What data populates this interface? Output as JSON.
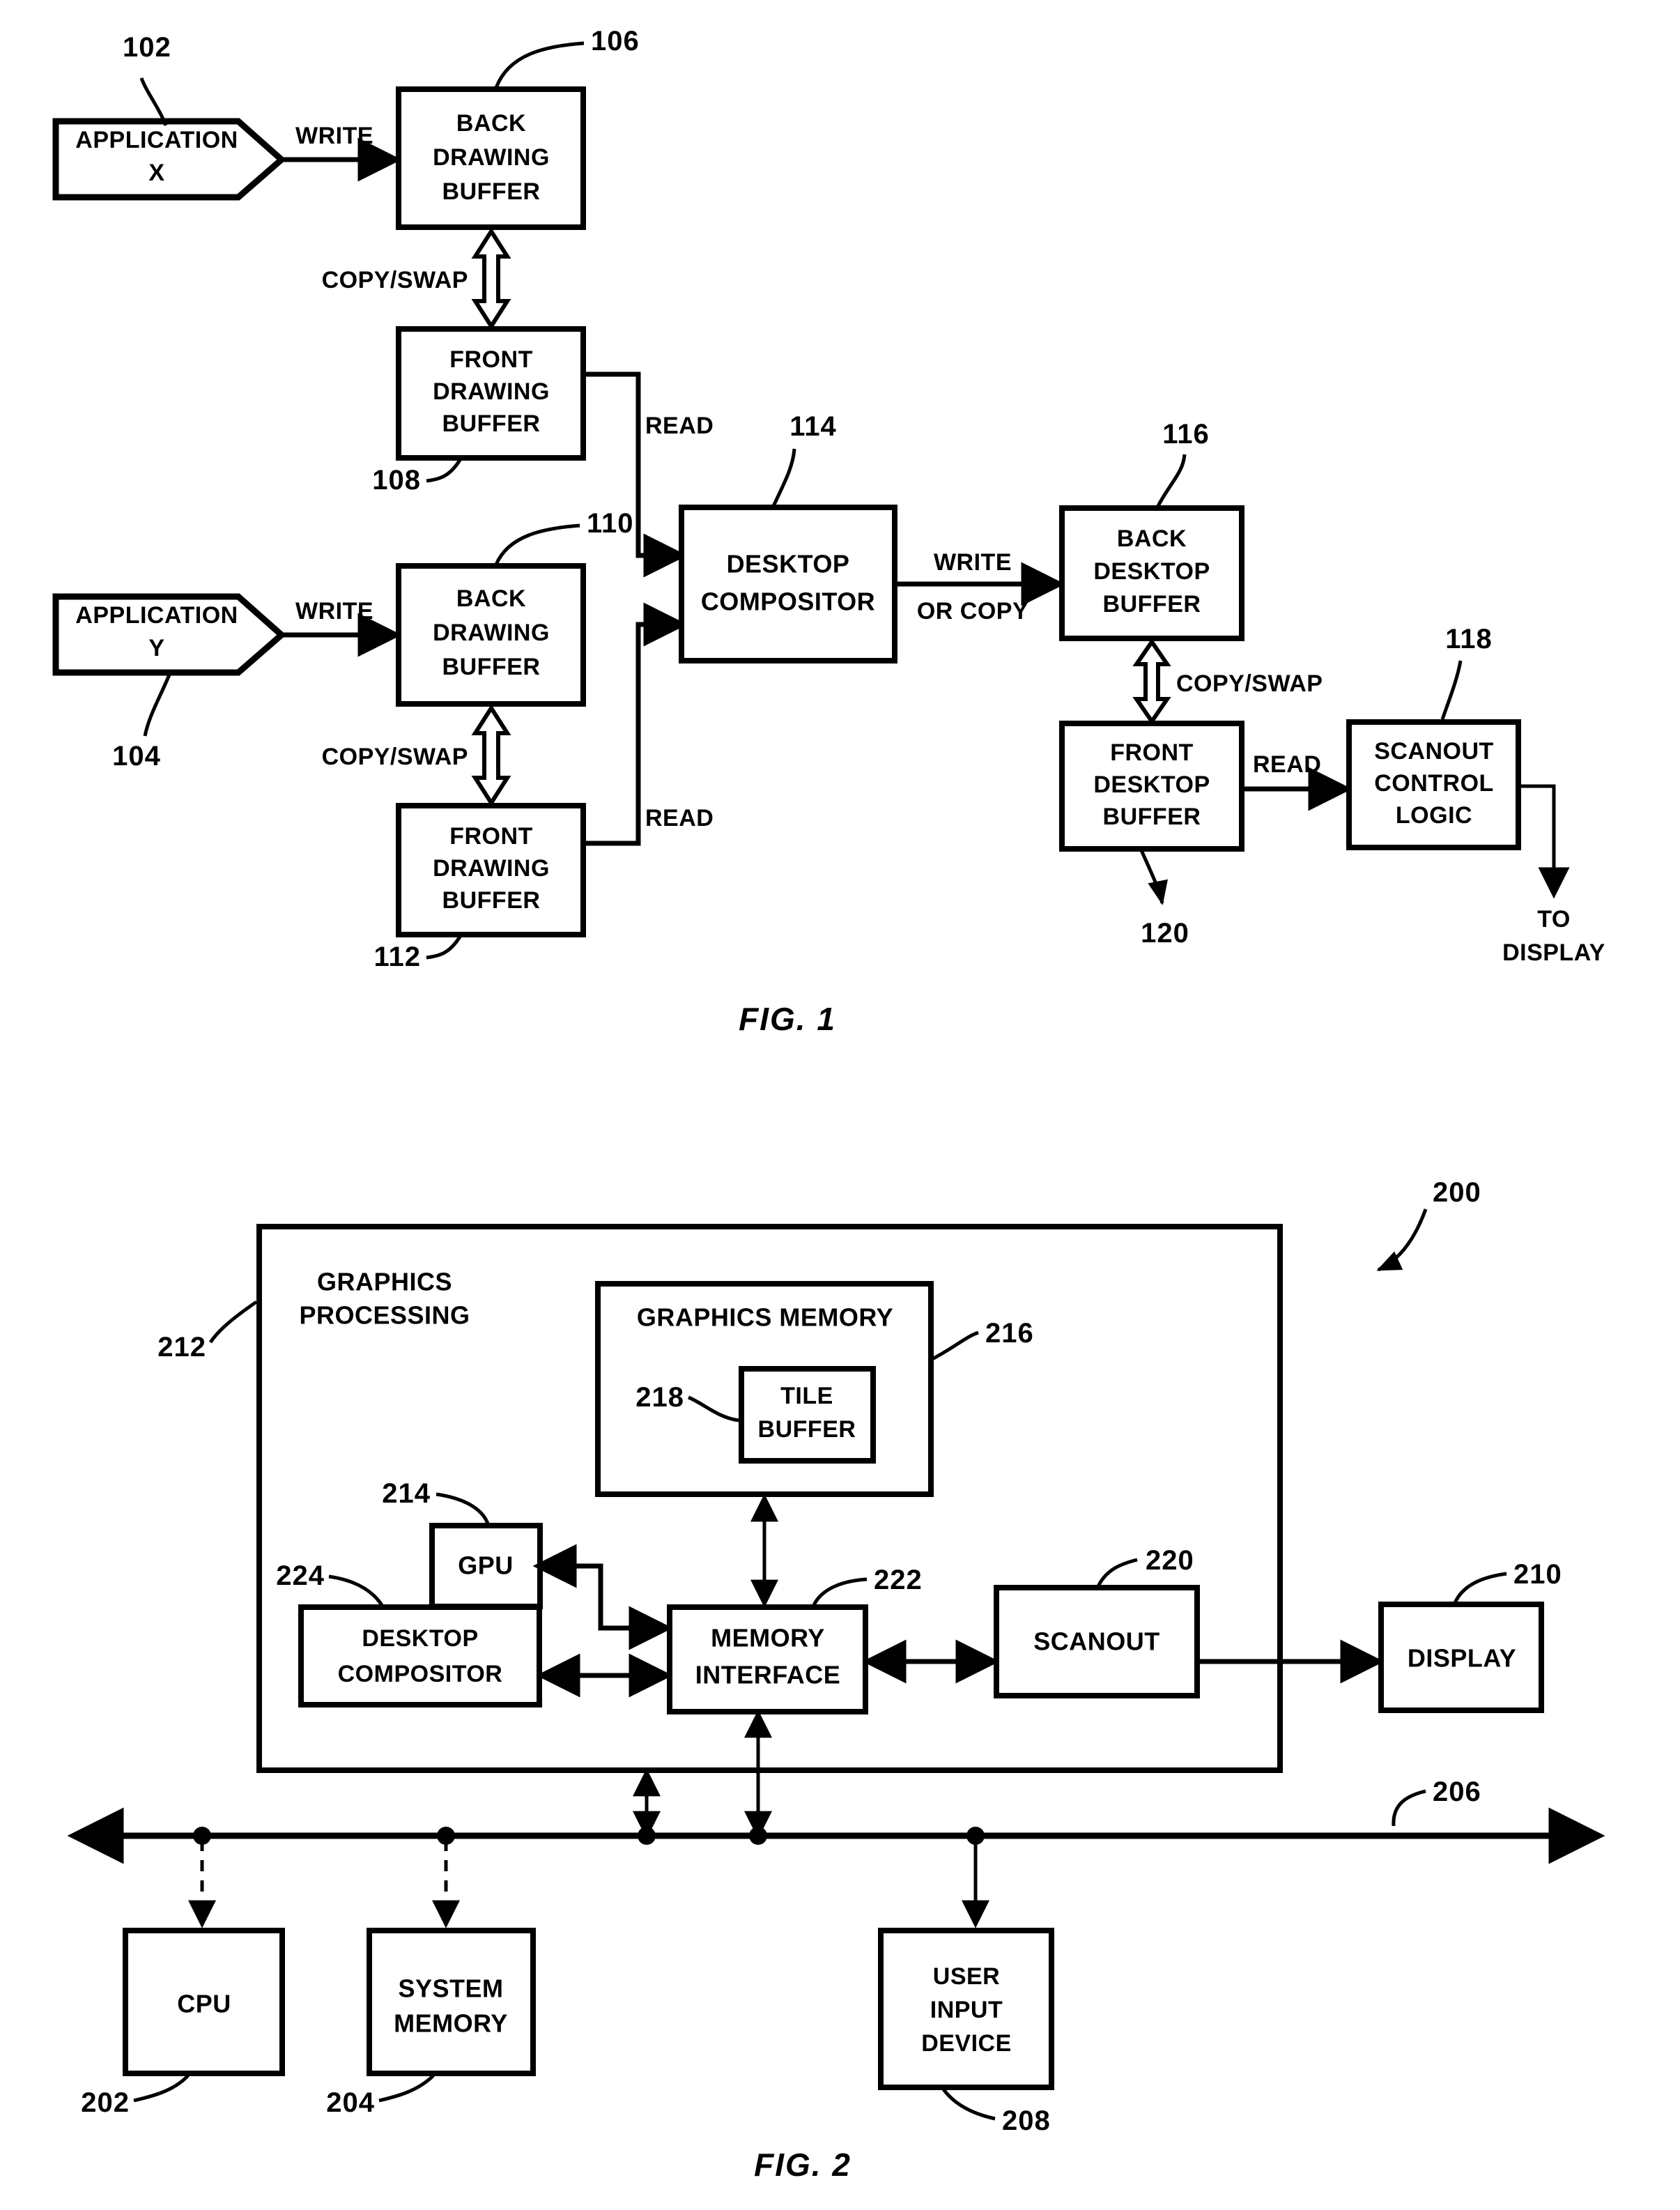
{
  "figure1": {
    "caption": "FIG. 1",
    "nodes": {
      "application_x": {
        "label_line1": "APPLICATION",
        "label_line2": "X",
        "ref": "102"
      },
      "application_y": {
        "label_line1": "APPLICATION",
        "label_line2": "Y",
        "ref": "104"
      },
      "back_drawing_buffer_x": {
        "label_line1": "BACK",
        "label_line2": "DRAWING",
        "label_line3": "BUFFER",
        "ref": "106"
      },
      "front_drawing_buffer_x": {
        "label_line1": "FRONT",
        "label_line2": "DRAWING",
        "label_line3": "BUFFER",
        "ref": "108"
      },
      "back_drawing_buffer_y": {
        "label_line1": "BACK",
        "label_line2": "DRAWING",
        "label_line3": "BUFFER",
        "ref": "110"
      },
      "front_drawing_buffer_y": {
        "label_line1": "FRONT",
        "label_line2": "DRAWING",
        "label_line3": "BUFFER",
        "ref": "112"
      },
      "desktop_compositor": {
        "label_line1": "DESKTOP",
        "label_line2": "COMPOSITOR",
        "ref": "114"
      },
      "back_desktop_buffer": {
        "label_line1": "BACK",
        "label_line2": "DESKTOP",
        "label_line3": "BUFFER",
        "ref": "116"
      },
      "front_desktop_buffer": {
        "label_line1": "FRONT",
        "label_line2": "DESKTOP",
        "label_line3": "BUFFER",
        "ref": "120"
      },
      "scanout_control_logic": {
        "label_line1": "SCANOUT",
        "label_line2": "CONTROL",
        "label_line3": "LOGIC",
        "ref": "118"
      }
    },
    "edges": {
      "write_x": "WRITE",
      "write_y": "WRITE",
      "copy_swap_x": "COPY/SWAP",
      "copy_swap_y": "COPY/SWAP",
      "read_x": "READ",
      "read_y": "READ",
      "write_or_copy_line1": "WRITE",
      "write_or_copy_line2": "OR COPY",
      "copy_swap_desktop": "COPY/SWAP",
      "read_desktop": "READ",
      "to_display_line1": "TO",
      "to_display_line2": "DISPLAY"
    }
  },
  "figure2": {
    "caption": "FIG. 2",
    "system_ref": "200",
    "nodes": {
      "graphics_processing": {
        "label_line1": "GRAPHICS",
        "label_line2": "PROCESSING",
        "ref": "212"
      },
      "graphics_memory": {
        "label": "GRAPHICS MEMORY",
        "ref": "216"
      },
      "tile_buffer": {
        "label_line1": "TILE",
        "label_line2": "BUFFER",
        "ref": "218"
      },
      "gpu": {
        "label": "GPU",
        "ref": "214"
      },
      "desktop_compositor": {
        "label_line1": "DESKTOP",
        "label_line2": "COMPOSITOR",
        "ref": "224"
      },
      "memory_interface": {
        "label_line1": "MEMORY",
        "label_line2": "INTERFACE",
        "ref": "222"
      },
      "scanout": {
        "label": "SCANOUT",
        "ref": "220"
      },
      "display": {
        "label": "DISPLAY",
        "ref": "210"
      },
      "cpu": {
        "label": "CPU",
        "ref": "202"
      },
      "system_memory": {
        "label_line1": "SYSTEM",
        "label_line2": "MEMORY",
        "ref": "204"
      },
      "user_input_device": {
        "label_line1": "USER",
        "label_line2": "INPUT",
        "label_line3": "DEVICE",
        "ref": "208"
      },
      "bus": {
        "ref": "206"
      }
    }
  },
  "colors": {
    "ink": "#000000",
    "paper": "#ffffff"
  }
}
